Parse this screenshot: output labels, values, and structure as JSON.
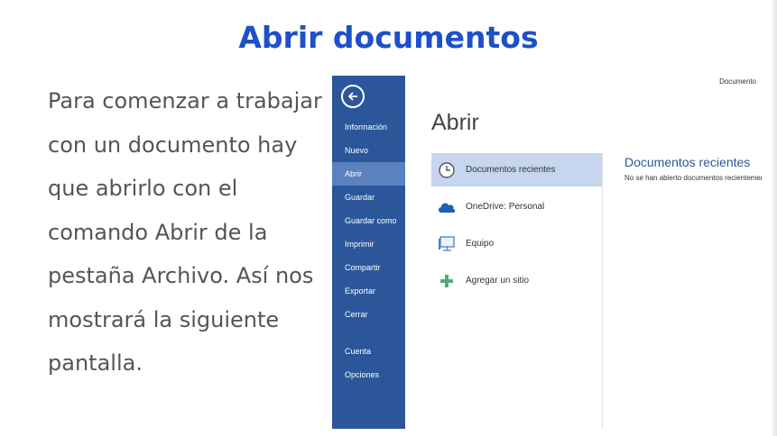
{
  "slide": {
    "title": "Abrir documentos",
    "body": "Para comenzar a trabajar con un documento hay que abrirlo con el comando Abrir de la pestaña Archivo. Así nos mostrará la siguiente pantalla."
  },
  "screenshot": {
    "doc_label": "Documento",
    "backstage": {
      "back_icon": "back-arrow-icon",
      "items_top": [
        "Información",
        "Nuevo",
        "Abrir",
        "Guardar",
        "Guardar como",
        "Imprimir",
        "Compartir",
        "Exportar",
        "Cerrar"
      ],
      "items_bottom": [
        "Cuenta",
        "Opciones"
      ],
      "active_item": "Abrir"
    },
    "heading": "Abrir",
    "places": [
      {
        "label": "Documentos recientes",
        "icon": "clock-icon"
      },
      {
        "label": "OneDrive: Personal",
        "icon": "cloud-icon"
      },
      {
        "label": "Equipo",
        "icon": "computer-icon"
      },
      {
        "label": "Agregar un sitio",
        "icon": "plus-icon"
      }
    ],
    "recent": {
      "heading": "Documentos recientes",
      "empty_text": "No se han abierto documentos recientemente"
    }
  },
  "colors": {
    "title": "#1e50c8",
    "backstage": "#2b579a",
    "backstage_active": "#5b82be",
    "place_active": "#c5d6ee"
  }
}
